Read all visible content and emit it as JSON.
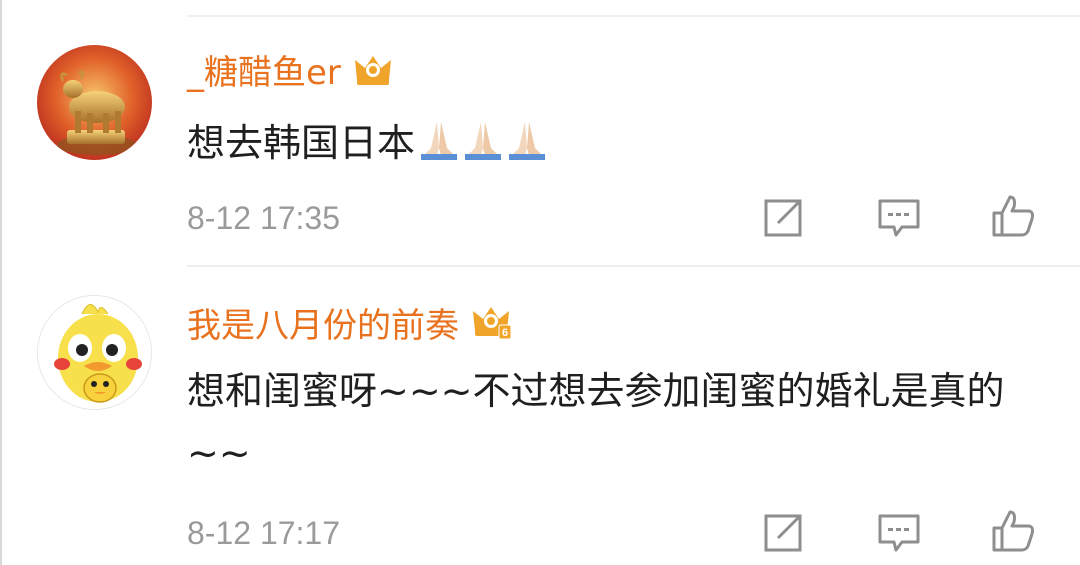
{
  "comments": [
    {
      "username": "_糖醋鱼er",
      "crown_level": "",
      "content": "想去韩国日本",
      "emojis": [
        "folded-hands",
        "folded-hands",
        "folded-hands"
      ],
      "timestamp": "8-12 17:35"
    },
    {
      "username": "我是八月份的前奏",
      "crown_level": "6",
      "content": "想和闺蜜呀~~~不过想去参加闺蜜的婚礼是真的~~",
      "emojis": [],
      "timestamp": "8-12 17:17"
    }
  ],
  "actions": [
    "share-icon",
    "comment-icon",
    "like-icon"
  ],
  "colors": {
    "username": "#e8721e",
    "content": "#1f1f1f",
    "timestamp": "#9a9a9a",
    "icon": "#8e8e8e"
  }
}
